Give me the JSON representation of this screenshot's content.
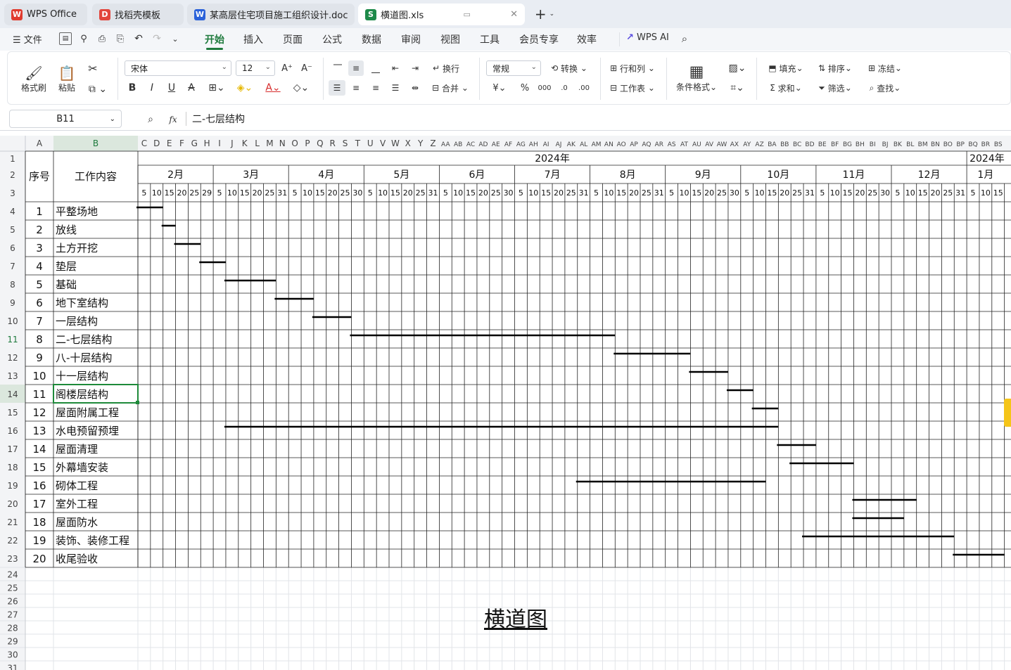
{
  "tabs": [
    {
      "label": "WPS Office",
      "icon": "wps-logo-icon"
    },
    {
      "label": "找稻壳模板",
      "icon": "docer-icon"
    },
    {
      "label": "某高层住宅项目施工组织设计.doc",
      "icon": "word-doc-icon"
    },
    {
      "label": "横道图.xls",
      "icon": "sheet-icon"
    }
  ],
  "menu": {
    "file": "文件",
    "items": [
      "开始",
      "插入",
      "页面",
      "公式",
      "数据",
      "审阅",
      "视图",
      "工具",
      "会员专享",
      "效率"
    ],
    "ai": "WPS AI"
  },
  "ribbon": {
    "format_painter": "格式刷",
    "paste": "粘贴",
    "font_name": "宋体",
    "font_size": "12",
    "wrap": "换行",
    "merge": "合并",
    "number_format": "常规",
    "convert": "转换",
    "row_col": "行和列",
    "worksheet": "工作表",
    "cond_format": "条件格式",
    "fill": "填充",
    "sort": "排序",
    "freeze": "冻结",
    "sum": "求和",
    "filter": "筛选",
    "find": "查找"
  },
  "formula_bar": {
    "cell_ref": "B11",
    "fx": "fx",
    "content": "二-七层结构"
  },
  "sheet": {
    "col_letters": [
      "C",
      "D",
      "E",
      "F",
      "G",
      "H",
      "I",
      "J",
      "K",
      "L",
      "M",
      "N",
      "O",
      "P",
      "Q",
      "R",
      "S",
      "T",
      "U",
      "V",
      "W",
      "X",
      "Y",
      "Z",
      "AA",
      "AB",
      "AC",
      "AD",
      "AE",
      "AF",
      "AG",
      "AH",
      "AI",
      "AJ",
      "AK",
      "AL",
      "AM",
      "AN",
      "AO",
      "AP",
      "AQ",
      "AR",
      "AS",
      "AT",
      "AU",
      "AV",
      "AW",
      "AX",
      "AY",
      "AZ",
      "BA",
      "BB",
      "BC",
      "BD",
      "BE",
      "BF",
      "BG",
      "BH",
      "BI",
      "BJ",
      "BK",
      "BL",
      "BM",
      "BN",
      "BO",
      "BP",
      "BQ",
      "BR",
      "BS"
    ],
    "year": "2024年",
    "year2": "2024年",
    "months": [
      "2月",
      "3月",
      "4月",
      "5月",
      "6月",
      "7月",
      "8月",
      "9月",
      "10月",
      "11月",
      "12月",
      "1月"
    ],
    "days": [
      "5",
      "10",
      "15",
      "20",
      "25",
      "29",
      "5",
      "10",
      "15",
      "20",
      "25",
      "31",
      "5",
      "10",
      "15",
      "20",
      "25",
      "30",
      "5",
      "10",
      "15",
      "20",
      "25",
      "31",
      "5",
      "10",
      "15",
      "20",
      "25",
      "30",
      "5",
      "10",
      "15",
      "20",
      "25",
      "31",
      "5",
      "10",
      "15",
      "20",
      "25",
      "31",
      "5",
      "10",
      "15",
      "20",
      "25",
      "30",
      "5",
      "10",
      "15",
      "20",
      "25",
      "31",
      "5",
      "10",
      "15",
      "20",
      "25",
      "30",
      "5",
      "10",
      "15",
      "20",
      "25",
      "31",
      "5",
      "10",
      "15"
    ],
    "header_no": "序号",
    "header_task": "工作内容",
    "tasks": [
      {
        "no": "1",
        "name": "平整场地",
        "start": 0,
        "end": 2
      },
      {
        "no": "2",
        "name": "放线",
        "start": 2,
        "end": 3
      },
      {
        "no": "3",
        "name": "土方开挖",
        "start": 3,
        "end": 5
      },
      {
        "no": "4",
        "name": "垫层",
        "start": 5,
        "end": 7
      },
      {
        "no": "5",
        "name": "基础",
        "start": 7,
        "end": 11
      },
      {
        "no": "6",
        "name": "地下室结构",
        "start": 11,
        "end": 14
      },
      {
        "no": "7",
        "name": "一层结构",
        "start": 14,
        "end": 17
      },
      {
        "no": "8",
        "name": "二-七层结构",
        "start": 17,
        "end": 38
      },
      {
        "no": "9",
        "name": "八-十层结构",
        "start": 38,
        "end": 44
      },
      {
        "no": "10",
        "name": "十一层结构",
        "start": 44,
        "end": 47
      },
      {
        "no": "11",
        "name": "阁楼层结构",
        "start": 47,
        "end": 49
      },
      {
        "no": "12",
        "name": "屋面附属工程",
        "start": 49,
        "end": 51
      },
      {
        "no": "13",
        "name": "水电预留预埋",
        "start": 7,
        "end": 51
      },
      {
        "no": "14",
        "name": "屋面清理",
        "start": 51,
        "end": 54
      },
      {
        "no": "15",
        "name": "外幕墙安装",
        "start": 52,
        "end": 57
      },
      {
        "no": "16",
        "name": "砌体工程",
        "start": 35,
        "end": 50
      },
      {
        "no": "17",
        "name": "室外工程",
        "start": 57,
        "end": 62
      },
      {
        "no": "18",
        "name": "屋面防水",
        "start": 57,
        "end": 61
      },
      {
        "no": "19",
        "name": "装饰、装修工程",
        "start": 53,
        "end": 65
      },
      {
        "no": "20",
        "name": "收尾验收",
        "start": 65,
        "end": 69
      }
    ],
    "chart_title": "横道图"
  }
}
